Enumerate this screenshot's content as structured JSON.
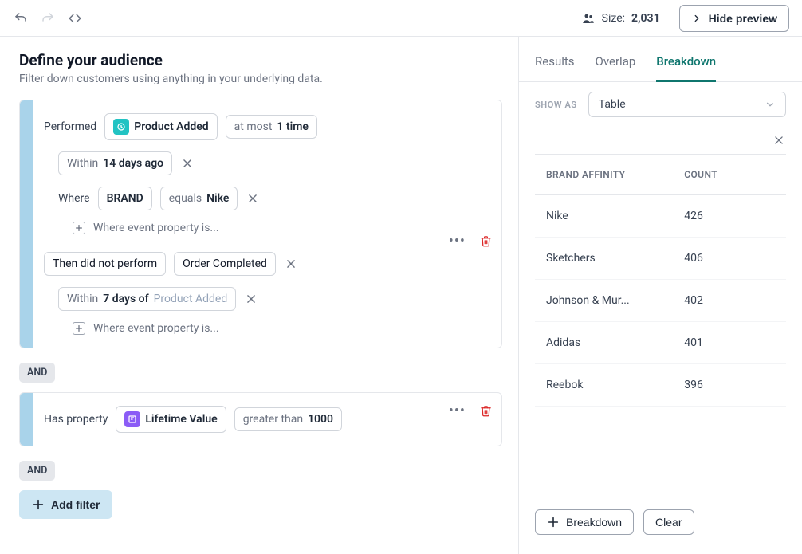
{
  "topbar": {
    "size_label": "Size:",
    "size_value": "2,031",
    "hide_preview": "Hide preview"
  },
  "header": {
    "title": "Define your audience",
    "subtitle": "Filter down customers using anything in your underlying data."
  },
  "group1": {
    "performed_label": "Performed",
    "product_added": "Product Added",
    "at_most_prefix": "at most ",
    "at_most_value": "1 time",
    "within_prefix": "Within ",
    "within_value": "14 days ago",
    "where_label": "Where",
    "brand": "BRAND",
    "equals_prefix": "equals ",
    "equals_value": "Nike",
    "where_event_prop": "Where event property is...",
    "then_not": "Then did not perform",
    "order_completed": "Order Completed",
    "funnel_within_prefix": "Within ",
    "funnel_within_value": "7 days of ",
    "funnel_ref": "Product Added",
    "where_event_prop2": "Where event property is..."
  },
  "and_label": "AND",
  "group2": {
    "has_property": "Has property",
    "lifetime_value": "Lifetime Value",
    "gt_prefix": "greater than ",
    "gt_value": "1000"
  },
  "add_filter": "Add filter",
  "tabs": {
    "results": "Results",
    "overlap": "Overlap",
    "breakdown": "Breakdown"
  },
  "show_as_label": "SHOW AS",
  "show_as_value": "Table",
  "table": {
    "header_brand": "BRAND AFFINITY",
    "header_count": "COUNT",
    "rows": [
      {
        "brand": "Nike",
        "count": "426"
      },
      {
        "brand": "Sketchers",
        "count": "406"
      },
      {
        "brand": "Johnson & Mur...",
        "count": "402"
      },
      {
        "brand": "Adidas",
        "count": "401"
      },
      {
        "brand": "Reebok",
        "count": "396"
      }
    ]
  },
  "footer": {
    "breakdown_btn": "Breakdown",
    "clear_btn": "Clear"
  }
}
